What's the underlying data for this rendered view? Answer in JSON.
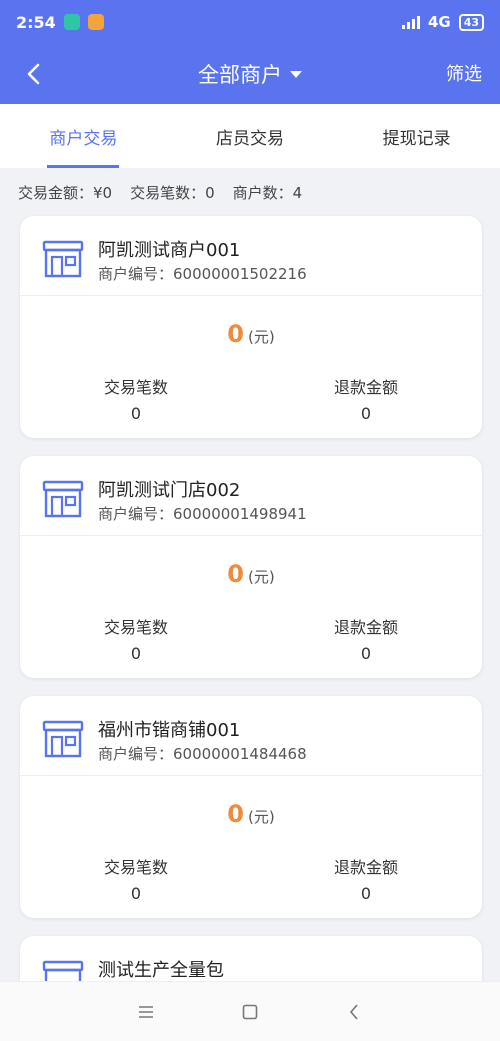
{
  "status_bar": {
    "time": "2:54",
    "network": "4G",
    "battery": "43"
  },
  "header": {
    "title": "全部商户",
    "filter_label": "筛选"
  },
  "tabs": [
    {
      "label": "商户交易",
      "active": true
    },
    {
      "label": "店员交易",
      "active": false
    },
    {
      "label": "提现记录",
      "active": false
    }
  ],
  "summary": {
    "amount_text": "交易金额：¥0",
    "count_text": "交易笔数：0",
    "merchant_text": "商户数：4"
  },
  "merchants": [
    {
      "name": "阿凯测试商户001",
      "id_label": "商户编号：",
      "id_value": "60000001502216",
      "amount": "0",
      "unit": "(元)",
      "count_label": "交易笔数",
      "count_value": "0",
      "refund_label": "退款金额",
      "refund_value": "0"
    },
    {
      "name": "阿凯测试门店002",
      "id_label": "商户编号：",
      "id_value": "60000001498941",
      "amount": "0",
      "unit": "(元)",
      "count_label": "交易笔数",
      "count_value": "0",
      "refund_label": "退款金额",
      "refund_value": "0"
    },
    {
      "name": "福州市锴商铺001",
      "id_label": "商户编号：",
      "id_value": "60000001484468",
      "amount": "0",
      "unit": "(元)",
      "count_label": "交易笔数",
      "count_value": "0",
      "refund_label": "退款金额",
      "refund_value": "0"
    },
    {
      "name": "测试生产全量包"
    }
  ],
  "colors": {
    "accent": "#5a74f0",
    "amount": "#f08a3c"
  }
}
